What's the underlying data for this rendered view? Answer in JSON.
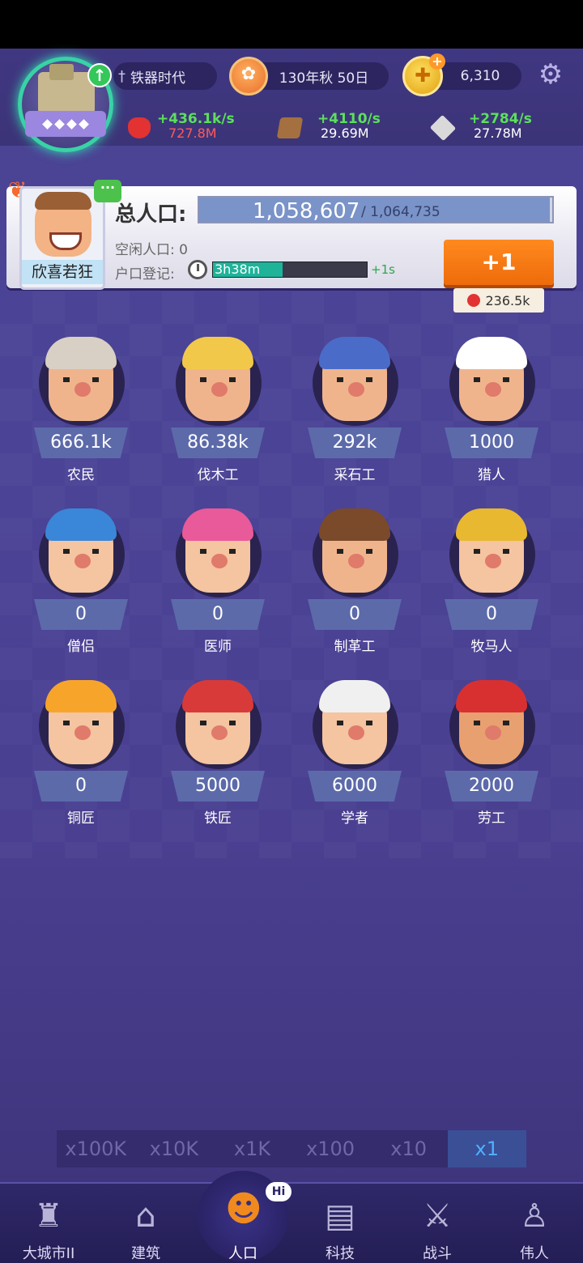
{
  "header": {
    "era": "铁器时代",
    "date": "130年秋 50日",
    "coins": "6,310",
    "resources": [
      {
        "name": "apple",
        "rate": "+436.1k/s",
        "amount": "727.8M",
        "amount_color": "#ff5a5a"
      },
      {
        "name": "wood",
        "rate": "+4110/s",
        "amount": "29.69M",
        "amount_color": "#ffffff"
      },
      {
        "name": "stone",
        "rate": "+2784/s",
        "amount": "27.78M",
        "amount_color": "#ffffff"
      }
    ]
  },
  "population": {
    "mood": "欣喜若狂",
    "label": "总人口:",
    "current": "1,058,607",
    "max": "/ 1,064,735",
    "fill_fraction": 0.994,
    "idle": "空闲人口: 0",
    "registration_label": "户口登记:",
    "registration_timer": "3h38m",
    "registration_fraction": 0.45,
    "registration_bonus": "+1s",
    "add_button": "+1",
    "cost": "236.5k"
  },
  "workers": [
    {
      "count": "666.1k",
      "name": "农民",
      "hair": "#d8d0c4",
      "skin": "#f0b48c"
    },
    {
      "count": "86.38k",
      "name": "伐木工",
      "hair": "#f2c84a",
      "skin": "#f0b48c"
    },
    {
      "count": "292k",
      "name": "采石工",
      "hair": "#4a6cc8",
      "skin": "#f0b48c"
    },
    {
      "count": "1000",
      "name": "猎人",
      "hair": "#ffffff",
      "skin": "#f0b48c"
    },
    {
      "count": "0",
      "name": "僧侣",
      "hair": "#3a86d8",
      "skin": "#f5c4a0"
    },
    {
      "count": "0",
      "name": "医师",
      "hair": "#e85a9a",
      "skin": "#f5c4a0"
    },
    {
      "count": "0",
      "name": "制革工",
      "hair": "#7a4a2a",
      "skin": "#f0b48c"
    },
    {
      "count": "0",
      "name": "牧马人",
      "hair": "#e8b830",
      "skin": "#f5c4a0"
    },
    {
      "count": "0",
      "name": "铜匠",
      "hair": "#f7a52a",
      "skin": "#f5c4a0"
    },
    {
      "count": "5000",
      "name": "铁匠",
      "hair": "#d83a3a",
      "skin": "#f5c4a0"
    },
    {
      "count": "6000",
      "name": "学者",
      "hair": "#f0f0f0",
      "skin": "#f5c4a0"
    },
    {
      "count": "2000",
      "name": "劳工",
      "hair": "#d83030",
      "skin": "#e8a070"
    }
  ],
  "multipliers": [
    "x100K",
    "x10K",
    "x1K",
    "x100",
    "x10",
    "x1"
  ],
  "multiplier_active": "x1",
  "nav": [
    {
      "label": "大城市II",
      "icon": "castle-icon"
    },
    {
      "label": "建筑",
      "icon": "house-icon"
    },
    {
      "label": "人口",
      "icon": "person-icon"
    },
    {
      "label": "科技",
      "icon": "book-icon"
    },
    {
      "label": "战斗",
      "icon": "swords-icon"
    },
    {
      "label": "伟人",
      "icon": "statue-icon"
    }
  ],
  "nav_active": "人口",
  "hi_badge": "Hi"
}
